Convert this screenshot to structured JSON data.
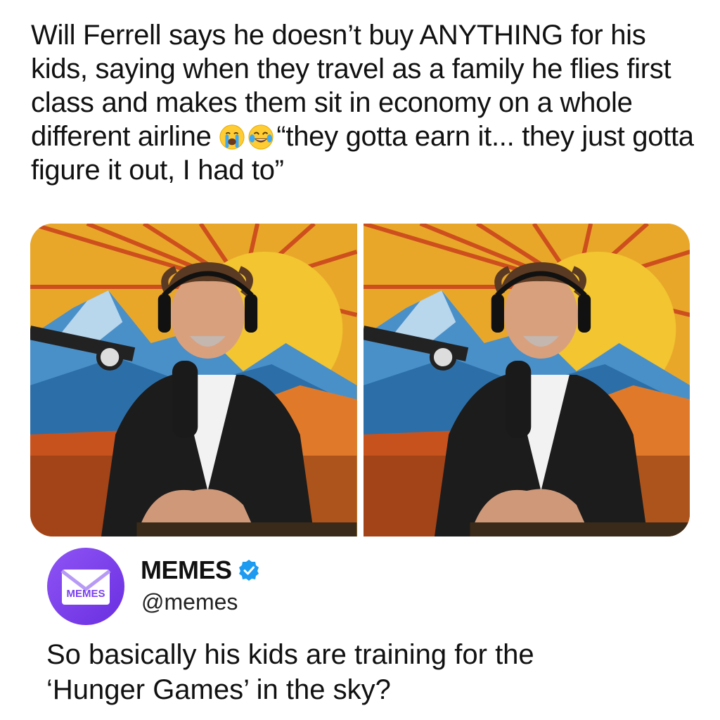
{
  "post": {
    "headline_part1": "Will Ferrell says he doesn’t buy ANYTHING for his kids, saying when they travel as a family he flies first class and makes them sit in economy on a whole different airline ",
    "headline_part2": "“they gotta earn it... they just gotta figure it out, I had to”",
    "emojis": [
      "loudly-crying-face-icon",
      "face-with-tears-of-joy-icon"
    ]
  },
  "author": {
    "avatar_label": "MEMES",
    "name": "MEMES",
    "handle": "@memes",
    "verified": true
  },
  "reply": {
    "line1": "So basically his kids are training for the",
    "line2": "‘Hunger Games’ in the sky?"
  },
  "colors": {
    "accent_verified": "#1d9bf0",
    "avatar_purple": "#7a3ff0"
  }
}
